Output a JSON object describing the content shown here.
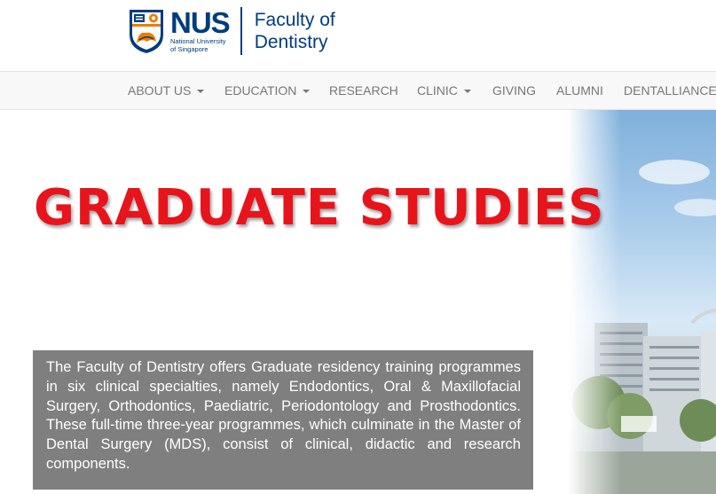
{
  "header": {
    "logo": {
      "wordmark": "NUS",
      "subtitle_line1": "National University",
      "subtitle_line2": "of Singapore",
      "faculty_line1": "Faculty of",
      "faculty_line2": "Dentistry"
    }
  },
  "nav": {
    "items": [
      {
        "label": "ABOUT US",
        "has_dropdown": true
      },
      {
        "label": "EDUCATION",
        "has_dropdown": true
      },
      {
        "label": "RESEARCH",
        "has_dropdown": false
      },
      {
        "label": "CLINIC",
        "has_dropdown": true
      },
      {
        "label": "GIVING",
        "has_dropdown": false
      },
      {
        "label": "ALUMNI",
        "has_dropdown": false
      },
      {
        "label": "DENTALLIANCE",
        "has_dropdown": false
      }
    ]
  },
  "hero": {
    "title": "GRADUATE STUDIES",
    "intro": "The Faculty of Dentistry offers Graduate residency training programmes in six clinical specialties, namely Endodontics, Oral & Maxillofacial Surgery, Orthodontics, Paediatric, Periodontology and Prosthodontics. These full-time three-year programmes, which culminate in the Master of Dental Surgery (MDS), consist of clinical, didactic and research components."
  },
  "colors": {
    "brand_blue": "#003d7c",
    "title_red": "#e8141b",
    "nav_text": "#777777",
    "intro_box": "#7f7f7f"
  }
}
